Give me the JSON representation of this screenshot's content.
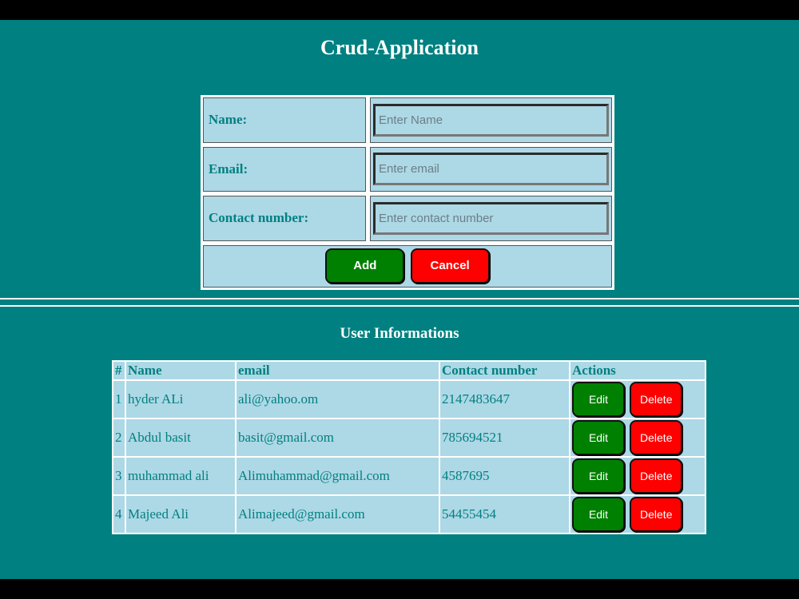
{
  "app": {
    "title": "Crud-Application",
    "subtitle": "User Informations"
  },
  "form": {
    "name_label": "Name:",
    "name_placeholder": "Enter Name",
    "email_label": "Email:",
    "email_placeholder": "Enter email",
    "contact_label": "Contact number:",
    "contact_placeholder": "Enter contact number",
    "add_label": "Add",
    "cancel_label": "Cancel"
  },
  "table": {
    "headers": [
      "#",
      "Name",
      "email",
      "Contact number",
      "Actions"
    ],
    "edit_label": "Edit",
    "delete_label": "Delete",
    "rows": [
      {
        "id": "1",
        "name": "hyder ALi",
        "email": "ali@yahoo.om",
        "contact": "2147483647"
      },
      {
        "id": "2",
        "name": "Abdul basit",
        "email": "basit@gmail.com",
        "contact": "785694521"
      },
      {
        "id": "3",
        "name": "muhammad ali",
        "email": "Alimuhammad@gmail.com",
        "contact": "4587695"
      },
      {
        "id": "4",
        "name": "Majeed Ali",
        "email": "Alimajeed@gmail.com",
        "contact": "54455454"
      }
    ]
  },
  "colors": {
    "background": "#008080",
    "panel": "#add8e6",
    "text": "#008080",
    "add_button": "#008000",
    "cancel_button": "#ff0000"
  }
}
